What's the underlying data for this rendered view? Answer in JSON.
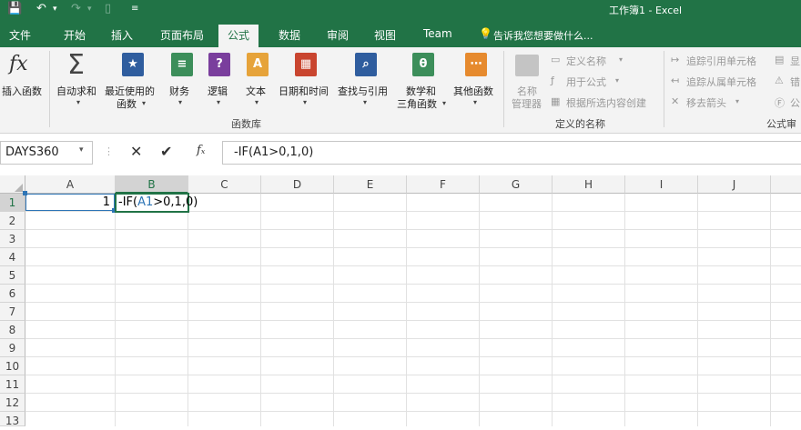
{
  "window": {
    "title": "工作簿1 - Excel"
  },
  "quick_access": {
    "save": "save-icon",
    "undo": "undo-icon",
    "redo": "redo-icon",
    "new": "new-doc-icon",
    "customize": "customize-icon"
  },
  "tabs": [
    "文件",
    "开始",
    "插入",
    "页面布局",
    "公式",
    "数据",
    "审阅",
    "视图",
    "Team"
  ],
  "active_tab": "公式",
  "tell_me": "告诉我您想要做什么...",
  "ribbon": {
    "function_library": {
      "group_label": "函数库",
      "insert_function": "插入函数",
      "autosum": "自动求和",
      "recent_line1": "最近使用的",
      "recent_line2": "函数",
      "financial": "财务",
      "logical": "逻辑",
      "text": "文本",
      "datetime": "日期和时间",
      "lookup": "查找与引用",
      "math_line1": "数学和",
      "math_line2": "三角函数",
      "more": "其他函数"
    },
    "defined_names": {
      "group_label": "定义的名称",
      "name_manager_line1": "名称",
      "name_manager_line2": "管理器",
      "define_name": "定义名称",
      "use_in_formula": "用于公式",
      "create_from_selection": "根据所选内容创建"
    },
    "formula_auditing": {
      "group_label": "公式审",
      "trace_precedents": "追踪引用单元格",
      "trace_dependents": "追踪从属单元格",
      "remove_arrows": "移去箭头",
      "show_formulas": "显",
      "error_checking": "错",
      "evaluate": "公"
    }
  },
  "formula_bar": {
    "name_box": "DAYS360",
    "formula": "-IF(A1>0,1,0)"
  },
  "columns": [
    "A",
    "B",
    "C",
    "D",
    "E",
    "F",
    "G",
    "H",
    "I",
    "J"
  ],
  "rows": [
    "1",
    "2",
    "3",
    "4",
    "5",
    "6",
    "7",
    "8",
    "9",
    "10",
    "11",
    "12",
    "13"
  ],
  "cells": {
    "A1": "1",
    "B1_prefix": "-IF(",
    "B1_ref": "A1",
    "B1_suffix": ">0,1,0)"
  },
  "colors": {
    "accent": "#217346",
    "ref": "#2e75b6"
  }
}
